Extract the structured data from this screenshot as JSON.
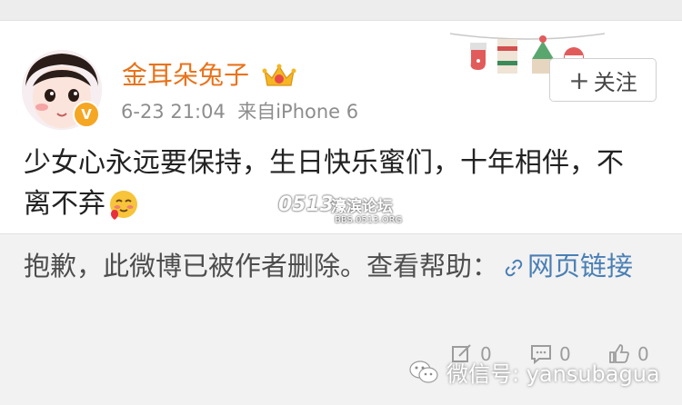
{
  "post": {
    "username": "金耳朵兔子",
    "timestamp": "6-23 21:04",
    "source": "来自iPhone 6",
    "follow_label": "关注",
    "text": "少女心永远要保持，生日快乐蜜们，十年相伴，不离不弃"
  },
  "watermark": {
    "logo_text": "0513",
    "site_name": "濠滨论坛",
    "url": "BBS.0513.ORG"
  },
  "deleted_notice": {
    "message": "抱歉，此微博已被作者删除。查看帮助：",
    "link_label": "网页链接"
  },
  "actions": {
    "repost_count": "0",
    "comment_count": "0",
    "like_count": "0"
  },
  "footer": {
    "wechat_label": "微信号: yansubagua"
  },
  "icons": [
    "vip-crown-icon",
    "verified-badge-icon",
    "plus-icon",
    "blush-emoji-icon",
    "link-icon",
    "repost-icon",
    "comment-icon",
    "like-icon",
    "wechat-icon"
  ],
  "colors": {
    "username": "#e8731b",
    "link": "#4a7fb5",
    "meta": "#8d8d8d",
    "badge": "#f5a623"
  }
}
